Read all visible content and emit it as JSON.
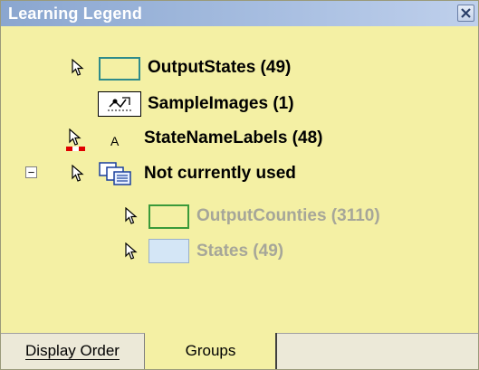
{
  "window": {
    "title": "Learning Legend",
    "close_icon": "close-x-icon"
  },
  "legend": {
    "items": [
      {
        "label": "OutputStates (49)",
        "icon": "cursor-arrow-icon",
        "swatch": "box-outline",
        "color": "#2e8b8b",
        "fill": "#f4f0a4",
        "dimmed": false
      },
      {
        "label": "SampleImages (1)",
        "icon": "",
        "swatch": "image-icon",
        "dimmed": false
      },
      {
        "label": "StateNameLabels (48)",
        "icon": "cursor-arrow-red-icon",
        "swatch": "text-label-icon",
        "swatch_text": "A",
        "dimmed": false
      },
      {
        "label": "Not currently used",
        "icon": "cursor-arrow-icon",
        "swatch": "group-layers-icon",
        "expander": "−",
        "dimmed": false
      },
      {
        "label": "OutputCounties (3110)",
        "icon": "cursor-arrow-icon",
        "swatch": "box-outline",
        "color": "#3a9a3a",
        "fill": "#f4f0a4",
        "dimmed": true
      },
      {
        "label": "States (49)",
        "icon": "cursor-arrow-icon",
        "swatch": "box-filled",
        "color": "#9ab0c8",
        "fill": "#d4e6f6",
        "dimmed": true
      }
    ]
  },
  "tabs": [
    {
      "label": "Display Order",
      "selected": false
    },
    {
      "label": "Groups",
      "selected": true
    }
  ],
  "colors": {
    "panel_bg": "#f4f0a4",
    "title_bar": "#8aa6cf",
    "dimmed_text": "#a6a699"
  }
}
